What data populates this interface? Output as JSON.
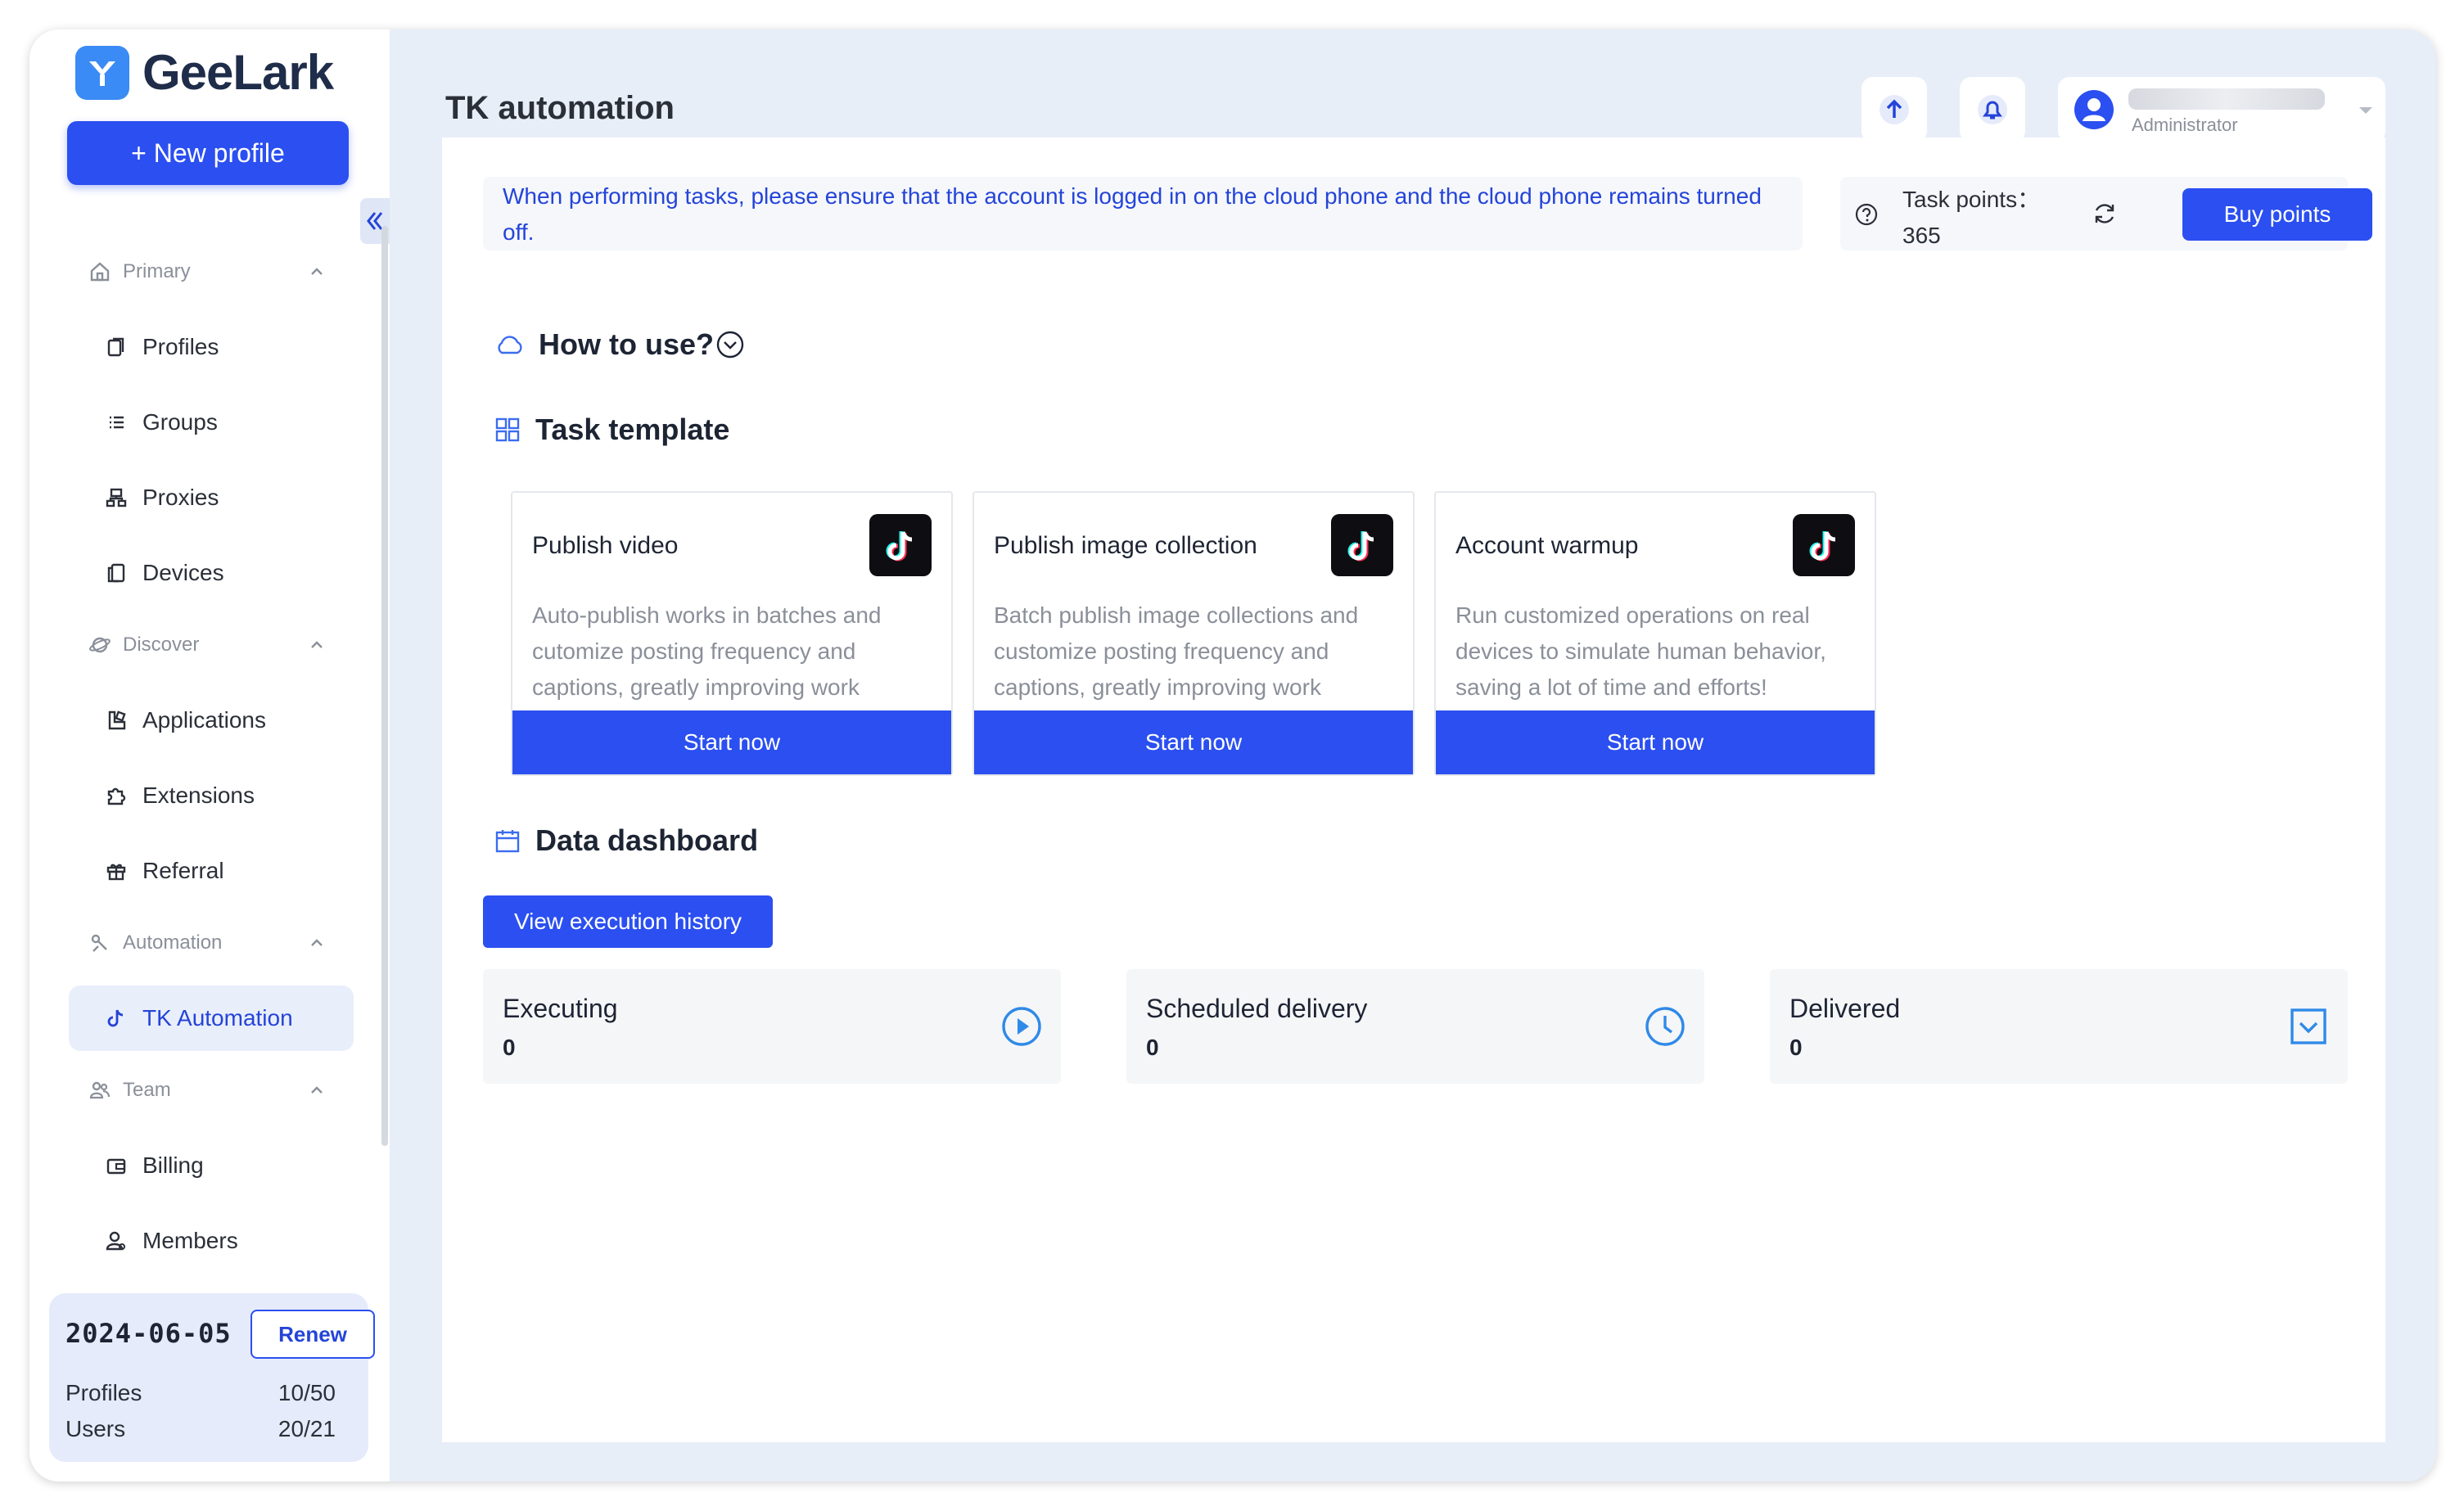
{
  "brand": {
    "name": "GeeLark",
    "accent": "#2b4ff0"
  },
  "sidebar": {
    "new_profile_label": "+ New profile",
    "sections": [
      {
        "label": "Primary",
        "items": [
          "Profiles",
          "Groups",
          "Proxies",
          "Devices"
        ]
      },
      {
        "label": "Discover",
        "items": [
          "Applications",
          "Extensions",
          "Referral"
        ]
      },
      {
        "label": "Automation",
        "items": [
          "TK Automation"
        ]
      },
      {
        "label": "Team",
        "items": [
          "Billing",
          "Members"
        ]
      }
    ],
    "active_item": "TK Automation",
    "plan": {
      "expiry": "2024-06-05",
      "renew_label": "Renew",
      "profiles_label": "Profiles",
      "profiles_value": "10/50",
      "users_label": "Users",
      "users_value": "20/21"
    }
  },
  "header": {
    "title": "TK automation",
    "user_role": "Administrator"
  },
  "main": {
    "notice": "When performing tasks, please ensure that the account is logged in on the cloud phone and the cloud phone remains turned off.",
    "points_label": "Task points：",
    "points_value": "365",
    "buy_label": "Buy points",
    "how_to_use": "How to use?",
    "task_template_title": "Task template",
    "templates": [
      {
        "title": "Publish video",
        "desc": "Auto-publish works in batches and cutomize posting frequency and captions, greatly improving work",
        "button": "Start now"
      },
      {
        "title": "Publish image collection",
        "desc": "Batch publish image collections and customize posting frequency and captions, greatly improving work",
        "button": "Start now"
      },
      {
        "title": "Account warmup",
        "desc": "Run customized operations on real devices to simulate human behavior, saving a lot of time and efforts!",
        "button": "Start now"
      }
    ],
    "dashboard_title": "Data dashboard",
    "history_label": "View execution history",
    "stats": [
      {
        "label": "Executing",
        "value": "0",
        "icon": "play-circle-icon"
      },
      {
        "label": "Scheduled delivery",
        "value": "0",
        "icon": "clock-icon"
      },
      {
        "label": "Delivered",
        "value": "0",
        "icon": "check-box-icon"
      }
    ]
  }
}
